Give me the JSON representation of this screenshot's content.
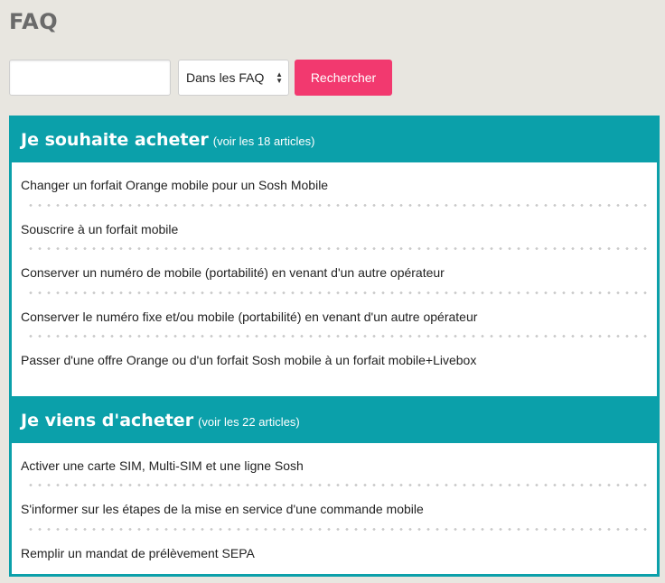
{
  "page": {
    "title": "FAQ"
  },
  "search": {
    "input_value": "",
    "placeholder": "",
    "scope_selected": "Dans les FAQ",
    "button_label": "Rechercher"
  },
  "colors": {
    "background": "#e8e6e0",
    "teal": "#0ba0aa",
    "pink": "#f2396f"
  },
  "sections": [
    {
      "title": "Je souhaite acheter",
      "count_link": "(voir les 18 articles)",
      "items": [
        "Changer un forfait Orange mobile pour un Sosh Mobile",
        "Souscrire à un forfait mobile",
        "Conserver un numéro de mobile (portabilité) en venant d'un autre opérateur",
        "Conserver le numéro fixe et/ou mobile (portabilité) en venant d'un autre opérateur",
        "Passer d'une offre Orange ou d'un forfait Sosh mobile à un forfait mobile+Livebox"
      ]
    },
    {
      "title": "Je viens d'acheter",
      "count_link": "(voir les 22 articles)",
      "items": [
        "Activer une carte SIM, Multi-SIM et une ligne Sosh",
        "S'informer sur les étapes de la mise en service d'une commande mobile",
        "Remplir un mandat de prélèvement SEPA"
      ]
    }
  ]
}
